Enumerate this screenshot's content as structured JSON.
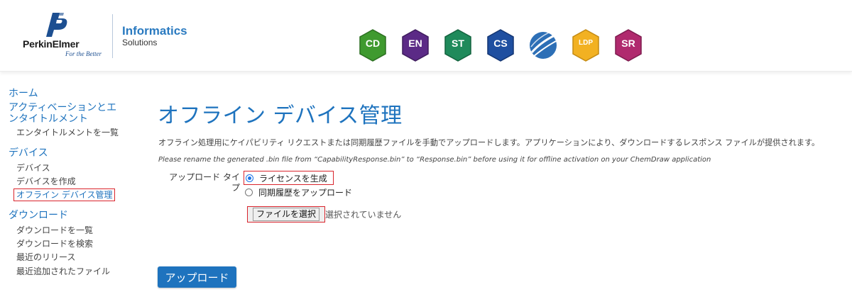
{
  "header": {
    "brand": {
      "name": "PerkinElmer",
      "tagline": "For the Better",
      "division": "Informatics",
      "division_sub": "Solutions"
    },
    "products": [
      {
        "code": "CD",
        "color": "#3f9a2f",
        "icon": "chemdraw-hex-icon"
      },
      {
        "code": "EN",
        "color": "#5b2a86",
        "icon": "enotebook-hex-icon"
      },
      {
        "code": "ST",
        "color": "#1f8a5b",
        "icon": "signals-hex-icon"
      },
      {
        "code": "CS",
        "color": "#1f4fa0",
        "icon": "chemscript-hex-icon"
      },
      {
        "code": "",
        "color": "#2d6fb6",
        "icon": "spotfire-globe-icon"
      },
      {
        "code": "LDP",
        "color": "#f2b122",
        "icon": "ldp-hex-icon"
      },
      {
        "code": "SR",
        "color": "#b02a6e",
        "icon": "sr-hex-icon"
      }
    ]
  },
  "sidebar": {
    "sections": [
      {
        "title": "ホーム",
        "items": []
      },
      {
        "title": "アクティベーションとエンタイトルメント",
        "items": [
          "エンタイトルメントを一覧"
        ]
      },
      {
        "title": "デバイス",
        "items": [
          "デバイス",
          "デバイスを作成",
          "オフライン デバイス管理"
        ]
      },
      {
        "title": "ダウンロード",
        "items": [
          "ダウンロードを一覧",
          "ダウンロードを検索",
          "最近のリリース",
          "最近追加されたファイル"
        ]
      }
    ]
  },
  "main": {
    "title": "オフライン デバイス管理",
    "description": "オフライン処理用にケイパビリティ リクエストまたは同期履歴ファイルを手動でアップロードします。アプリケーションにより、ダウンロードするレスポンス ファイルが提供されます。",
    "note": "Please rename the generated .bin file from “CapabilityResponse.bin” to “Response.bin” before using it for offline activation on your ChemDraw application",
    "upload_type_label": "アップロード タイプ",
    "options": [
      {
        "label": "ライセンスを生成",
        "checked": true
      },
      {
        "label": "同期履歴をアップロード",
        "checked": false
      }
    ],
    "file_button": "ファイルを選択",
    "file_status": "選択されていません",
    "upload_button": "アップロード"
  }
}
